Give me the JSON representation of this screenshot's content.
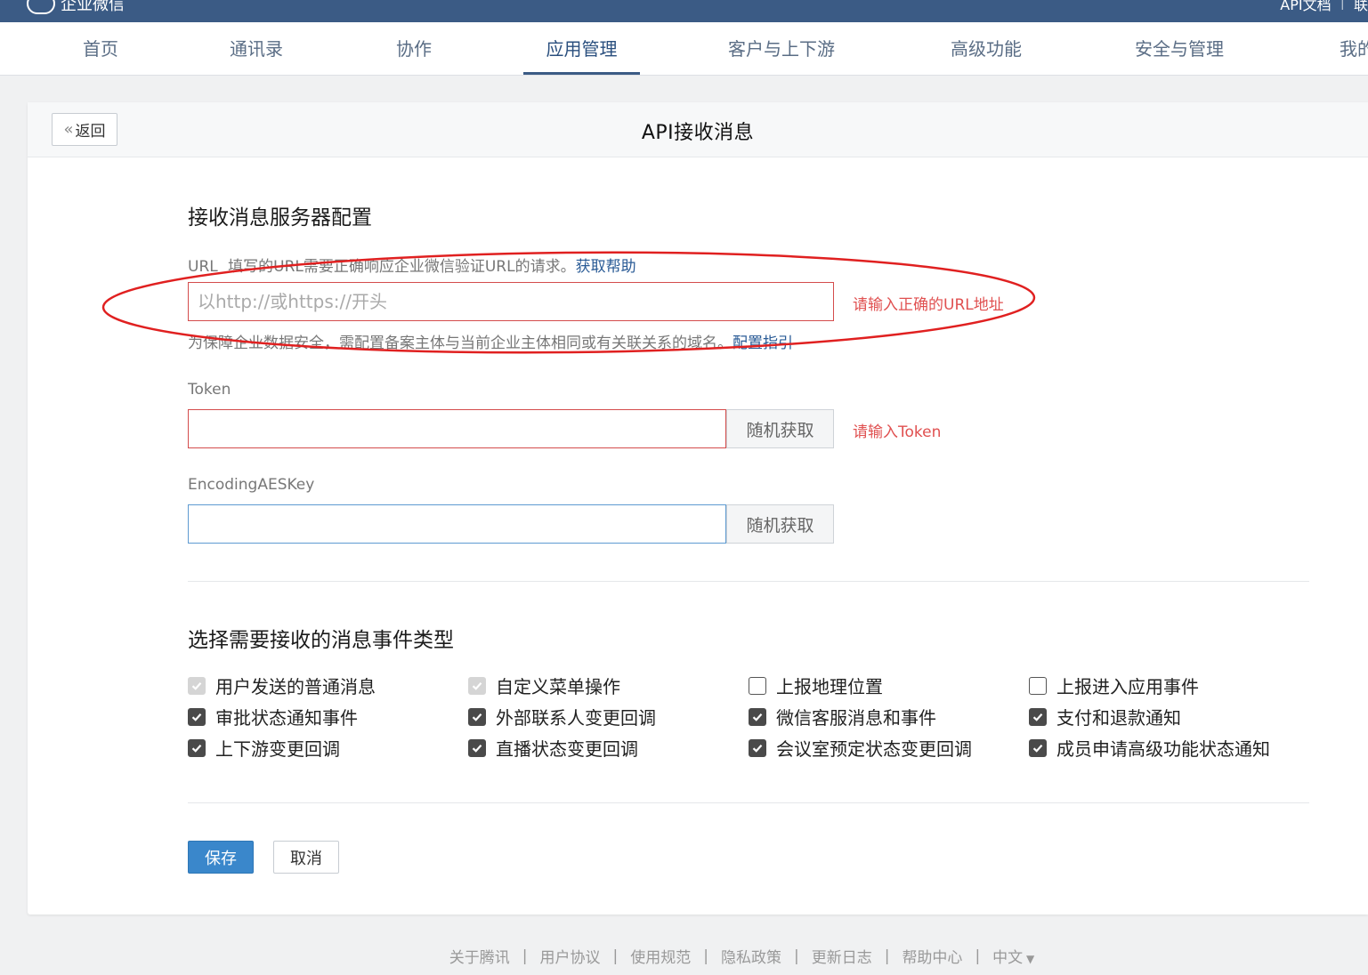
{
  "topbar": {
    "logo_text": "企业微信",
    "right_links": [
      "API文档",
      "联"
    ]
  },
  "nav": {
    "items": [
      {
        "label": "首页"
      },
      {
        "label": "通讯录"
      },
      {
        "label": "协作"
      },
      {
        "label": "应用管理",
        "active": true
      },
      {
        "label": "客户与上下游"
      },
      {
        "label": "高级功能"
      },
      {
        "label": "安全与管理"
      },
      {
        "label": "我的"
      }
    ]
  },
  "header": {
    "back_label": "返回",
    "title": "API接收消息"
  },
  "server_config": {
    "section_title": "接收消息服务器配置",
    "url_label": "URL",
    "url_desc": "填写的URL需要正确响应企业微信验证URL的请求。",
    "url_help_link": "获取帮助",
    "url_placeholder": "以http://或https://开头",
    "url_value": "",
    "url_error": "请输入正确的URL地址",
    "domain_hint": "为保障企业数据安全，需配置备案主体与当前企业主体相同或有关联关系的域名。",
    "domain_hint_link": "配置指引",
    "token_label": "Token",
    "token_value": "",
    "token_random_btn": "随机获取",
    "token_error": "请输入Token",
    "aes_label": "EncodingAESKey",
    "aes_value": "",
    "aes_random_btn": "随机获取"
  },
  "events": {
    "section_title": "选择需要接收的消息事件类型",
    "rows": [
      [
        {
          "label": "用户发送的普通消息",
          "checked": true,
          "disabled": true
        },
        {
          "label": "自定义菜单操作",
          "checked": true,
          "disabled": true
        },
        {
          "label": "上报地理位置",
          "checked": false,
          "disabled": false
        },
        {
          "label": "上报进入应用事件",
          "checked": false,
          "disabled": false
        }
      ],
      [
        {
          "label": "审批状态通知事件",
          "checked": true,
          "disabled": false
        },
        {
          "label": "外部联系人变更回调",
          "checked": true,
          "disabled": false
        },
        {
          "label": "微信客服消息和事件",
          "checked": true,
          "disabled": false
        },
        {
          "label": "支付和退款通知",
          "checked": true,
          "disabled": false
        }
      ],
      [
        {
          "label": "上下游变更回调",
          "checked": true,
          "disabled": false
        },
        {
          "label": "直播状态变更回调",
          "checked": true,
          "disabled": false
        },
        {
          "label": "会议室预定状态变更回调",
          "checked": true,
          "disabled": false
        },
        {
          "label": "成员申请高级功能状态通知",
          "checked": true,
          "disabled": false
        }
      ]
    ]
  },
  "actions": {
    "save_label": "保存",
    "cancel_label": "取消"
  },
  "footer": {
    "links": [
      "关于腾讯",
      "用户协议",
      "使用规范",
      "隐私政策",
      "更新日志",
      "帮助中心"
    ],
    "language": "中文"
  },
  "colors": {
    "topbar": "#3b5b85",
    "primary_button": "#3a87cb",
    "error": "#e05050",
    "annotation": "#e02020"
  }
}
